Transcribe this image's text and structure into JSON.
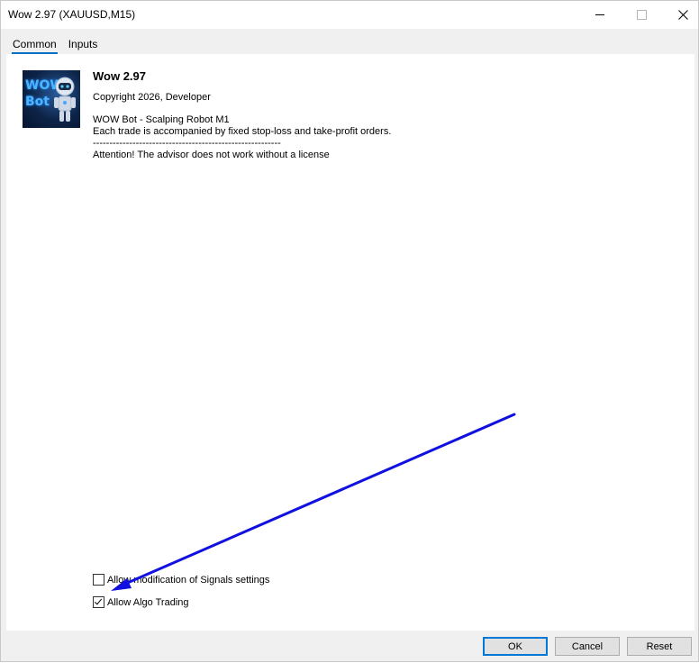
{
  "window": {
    "title": "Wow 2.97 (XAUUSD,M15)"
  },
  "tabs": [
    {
      "label": "Common",
      "active": true
    },
    {
      "label": "Inputs",
      "active": false
    }
  ],
  "logo": {
    "text_line1": "WOW",
    "text_line2": "Bot"
  },
  "info": {
    "name": "Wow 2.97",
    "copyright": "Copyright 2026, Developer",
    "description_lines": [
      "WOW Bot - Scalping Robot M1",
      "Each trade is accompanied by fixed stop-loss and take-profit orders.",
      "---------------------------------------------------------",
      "Attention! The advisor does not work without a license"
    ]
  },
  "options": {
    "allow_signals": {
      "label": "Allow modification of Signals settings",
      "checked": false
    },
    "allow_algo": {
      "label": "Allow Algo Trading",
      "checked": true
    }
  },
  "buttons": {
    "ok": "OK",
    "cancel": "Cancel",
    "reset": "Reset"
  },
  "colors": {
    "accent": "#0078d7",
    "annotation_arrow": "#1010e0"
  }
}
